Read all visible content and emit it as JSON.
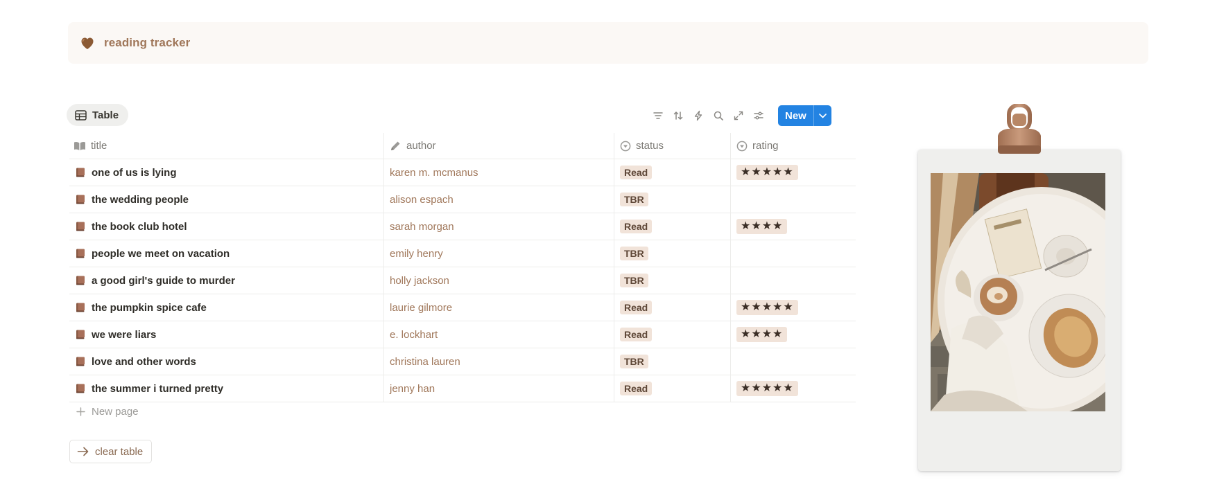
{
  "callout": {
    "title": "reading tracker",
    "icon": "brown-heart-icon"
  },
  "view": {
    "tab_label": "Table"
  },
  "toolbar": {
    "icons": [
      "filter-icon",
      "sort-icon",
      "automation-icon",
      "search-icon",
      "expand-icon",
      "settings-icon"
    ],
    "new_label": "New"
  },
  "columns": {
    "title": "title",
    "author": "author",
    "status": "status",
    "rating": "rating"
  },
  "rows": [
    {
      "title": "one of us is lying",
      "author": "karen m. mcmanus",
      "status": "Read",
      "rating": "★★★★★",
      "rating_value": 5
    },
    {
      "title": "the wedding people",
      "author": "alison espach",
      "status": "TBR",
      "rating": "",
      "rating_value": 0
    },
    {
      "title": "the book club hotel",
      "author": "sarah morgan",
      "status": "Read",
      "rating": "★★★★",
      "rating_value": 4
    },
    {
      "title": "people we meet on vacation",
      "author": "emily henry",
      "status": "TBR",
      "rating": "",
      "rating_value": 0
    },
    {
      "title": "a good girl's guide to murder",
      "author": "holly jackson",
      "status": "TBR",
      "rating": "",
      "rating_value": 0
    },
    {
      "title": "the pumpkin spice cafe",
      "author": "laurie gilmore",
      "status": "Read",
      "rating": "★★★★★",
      "rating_value": 5
    },
    {
      "title": "we were liars",
      "author": "e. lockhart",
      "status": "Read",
      "rating": "★★★★",
      "rating_value": 4
    },
    {
      "title": "love and other words",
      "author": "christina lauren",
      "status": "TBR",
      "rating": "",
      "rating_value": 0
    },
    {
      "title": "the summer i turned pretty",
      "author": "jenny han",
      "status": "Read",
      "rating": "★★★★★",
      "rating_value": 5
    }
  ],
  "footer": {
    "new_page_label": "New page",
    "clear_label": "clear table"
  },
  "colors": {
    "accent": "#a0775a",
    "pill_bg": "#f1e3d9",
    "new_button": "#2383e2",
    "callout_bg": "#fbf8f5"
  }
}
